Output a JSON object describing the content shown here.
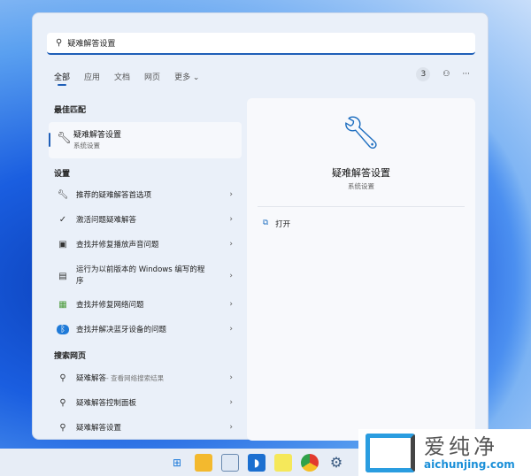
{
  "search": {
    "query": "疑难解答设置"
  },
  "tabs": [
    {
      "label": "全部"
    },
    {
      "label": "应用"
    },
    {
      "label": "文档"
    },
    {
      "label": "网页"
    },
    {
      "label": "更多 ⌄"
    }
  ],
  "tools": {
    "badge": "3",
    "more": "···"
  },
  "best_match": {
    "header": "最佳匹配",
    "title": "疑难解答设置",
    "subtitle": "系统设置"
  },
  "settings": {
    "header": "设置",
    "items": [
      {
        "label": "推荐的疑难解答首选项",
        "icon": "wrench-icon"
      },
      {
        "label": "激活问题疑难解答",
        "icon": "check-circle-icon"
      },
      {
        "label": "查找并修复播放声音问题",
        "icon": "audio-icon"
      },
      {
        "label": "运行为以前版本的 Windows 编写的程序",
        "icon": "compat-icon"
      },
      {
        "label": "查找并修复网络问题",
        "icon": "network-icon"
      },
      {
        "label": "查找并解决蓝牙设备的问题",
        "icon": "bluetooth-icon"
      }
    ]
  },
  "web": {
    "header": "搜索网页",
    "items": [
      {
        "label": "疑难解答",
        "sub": " - 查看网络搜索结果"
      },
      {
        "label": "疑难解答控制面板",
        "sub": ""
      },
      {
        "label": "疑难解答设置",
        "sub": ""
      }
    ]
  },
  "preview": {
    "title": "疑难解答设置",
    "subtitle": "系统设置",
    "open": "打开"
  },
  "watermark": {
    "cn": "爱纯净",
    "en": "aichunjing.com"
  }
}
